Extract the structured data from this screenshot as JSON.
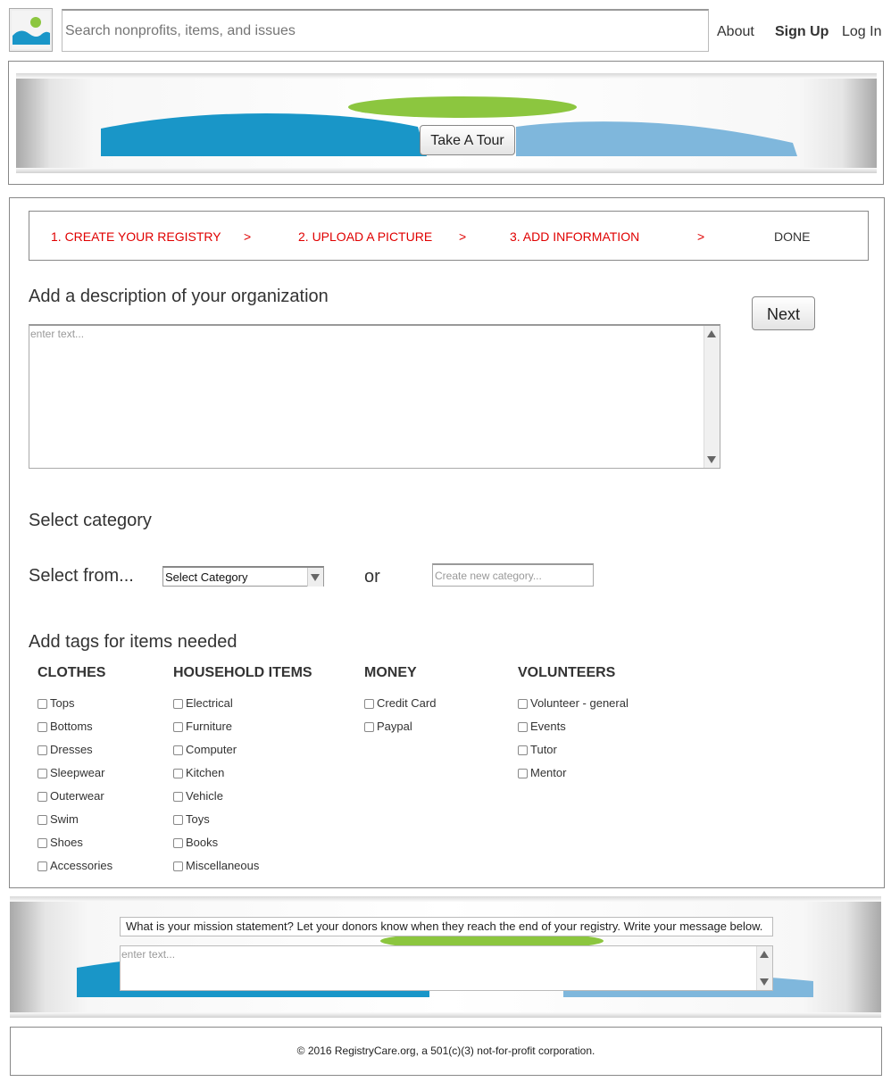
{
  "header": {
    "search_placeholder": "Search nonprofits, items, and issues",
    "nav": {
      "about": "About",
      "sign_up": "Sign Up",
      "log_in": "Log In"
    }
  },
  "banner": {
    "tour_button": "Take A Tour"
  },
  "steps": {
    "items": [
      "1. CREATE YOUR REGISTRY",
      "2. UPLOAD A PICTURE",
      "3. ADD INFORMATION",
      "DONE"
    ],
    "separator": ">"
  },
  "description": {
    "heading": "Add a description of your organization",
    "placeholder": "enter text...",
    "next_button": "Next"
  },
  "category": {
    "heading": "Select category",
    "select_from_label": "Select from...",
    "select_value": "Select Category",
    "or_label": "or",
    "new_placeholder": "Create new category..."
  },
  "tags": {
    "heading": "Add tags for items needed",
    "columns": [
      {
        "title": "CLOTHES",
        "items": [
          "Tops",
          "Bottoms",
          "Dresses",
          "Sleepwear",
          "Outerwear",
          "Swim",
          "Shoes",
          "Accessories"
        ]
      },
      {
        "title": "HOUSEHOLD ITEMS",
        "items": [
          "Electrical",
          "Furniture",
          "Computer",
          "Kitchen",
          "Vehicle",
          "Toys",
          "Books",
          "Miscellaneous"
        ]
      },
      {
        "title": "MONEY",
        "items": [
          "Credit Card",
          "Paypal"
        ]
      },
      {
        "title": "VOLUNTEERS",
        "items": [
          "Volunteer - general",
          "Events",
          "Tutor",
          "Mentor"
        ]
      }
    ]
  },
  "mission": {
    "question": "What is your mission statement? Let your donors know when they reach the end of your registry. Write your message below.",
    "placeholder": "enter text..."
  },
  "footer": {
    "text": "© 2016 RegistryCare.org, a 501(c)(3) not-for-profit corporation."
  },
  "colors": {
    "step_active": "#e00000",
    "banner_blue": "#1996c8",
    "banner_green": "#8cc63f"
  }
}
